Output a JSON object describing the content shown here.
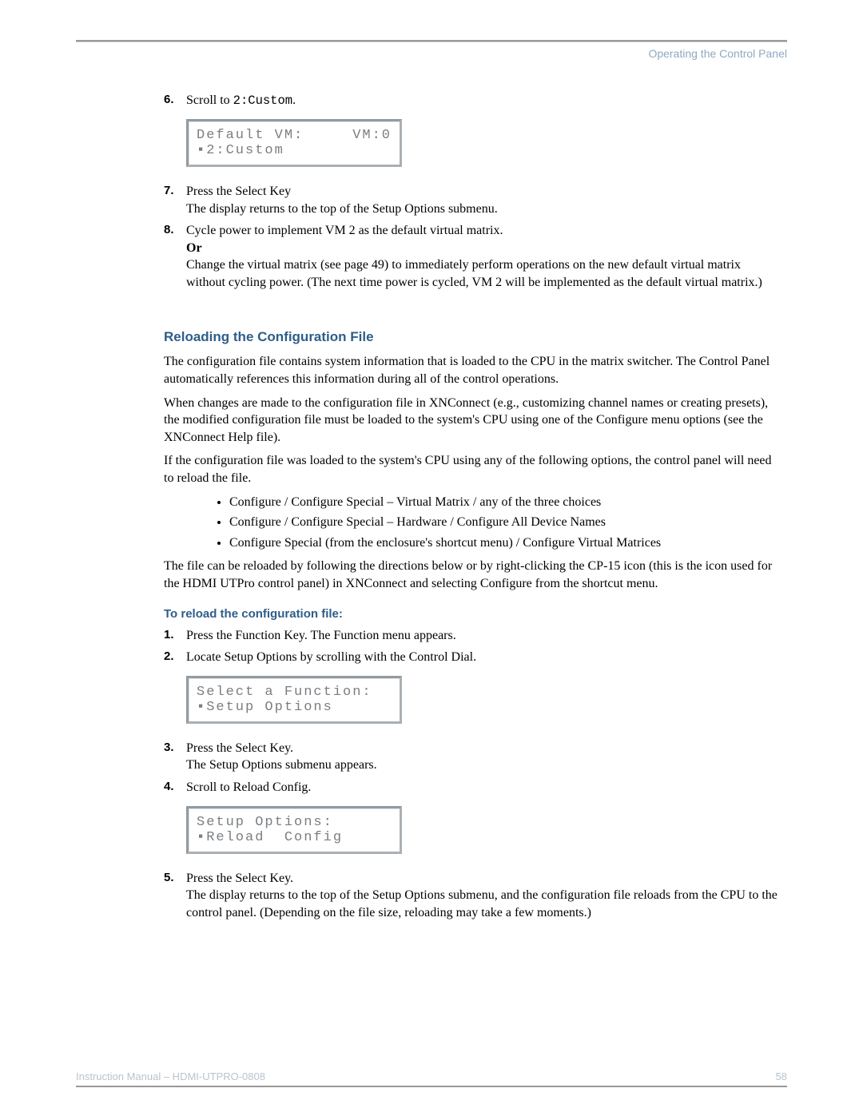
{
  "header": {
    "section": "Operating the Control Panel"
  },
  "step6": {
    "num": "6.",
    "text_a": "Scroll to ",
    "text_code": "2:Custom",
    "text_b": "."
  },
  "lcd1": {
    "line1_left": "Default VM:",
    "line1_right": "VM:0",
    "line2": "▪2:Custom"
  },
  "step7": {
    "num": "7.",
    "line1": "Press the Select Key",
    "line2": "The display returns to the top of the Setup Options submenu."
  },
  "step8": {
    "num": "8.",
    "line1": "Cycle power to implement VM 2 as the default virtual matrix.",
    "or": "Or",
    "line2": "Change the virtual matrix (see page 49) to immediately perform operations on the new default virtual matrix without cycling power. (The next time power is cycled, VM 2 will be implemented as the default virtual matrix.)"
  },
  "section2": {
    "heading": "Reloading the Configuration File",
    "p1": "The configuration file contains system information that is loaded to the CPU in the matrix switcher. The Control Panel automatically references this information during all of the control operations.",
    "p2": "When changes are made to the configuration file in XNConnect (e.g., customizing channel names or creating presets), the modified configuration file must be loaded to the system's CPU using one of the Configure menu options (see the XNConnect Help file).",
    "p3": "If the configuration file was loaded to the system's CPU using any of the following options, the control panel will need to reload the file.",
    "bullets": [
      "Configure / Configure Special – Virtual Matrix / any of the three choices",
      "Configure / Configure Special – Hardware / Configure All Device Names",
      "Configure Special (from the enclosure's shortcut menu) / Configure Virtual Matrices"
    ],
    "p4": "The file can be reloaded by following the directions below or by right-clicking the CP-15 icon (this is the icon used for the HDMI UTPro control panel) in XNConnect and selecting Configure from the shortcut menu."
  },
  "section3": {
    "heading": "To reload the configuration file:",
    "step1_num": "1.",
    "step1_text": "Press the Function Key. The Function menu appears.",
    "step2_num": "2.",
    "step2_text": "Locate Setup Options by scrolling with the Control Dial."
  },
  "lcd2": {
    "line1": "Select a Function:",
    "line2": "▪Setup Options"
  },
  "section3b": {
    "step3_num": "3.",
    "step3_l1": "Press the Select Key.",
    "step3_l2": "The Setup Options submenu appears.",
    "step4_num": "4.",
    "step4_text": "Scroll to Reload Config."
  },
  "lcd3": {
    "line1": "Setup Options:",
    "line2": "▪Reload  Config"
  },
  "section3c": {
    "step5_num": "5.",
    "step5_l1": "Press the Select Key.",
    "step5_l2": "The display returns to the top of the Setup Options submenu, and the configuration file reloads from the CPU to the control panel. (Depending on the file size, reloading may take a few moments.)"
  },
  "footer": {
    "left": "Instruction Manual – HDMI-UTPRO-0808",
    "right": "58"
  }
}
